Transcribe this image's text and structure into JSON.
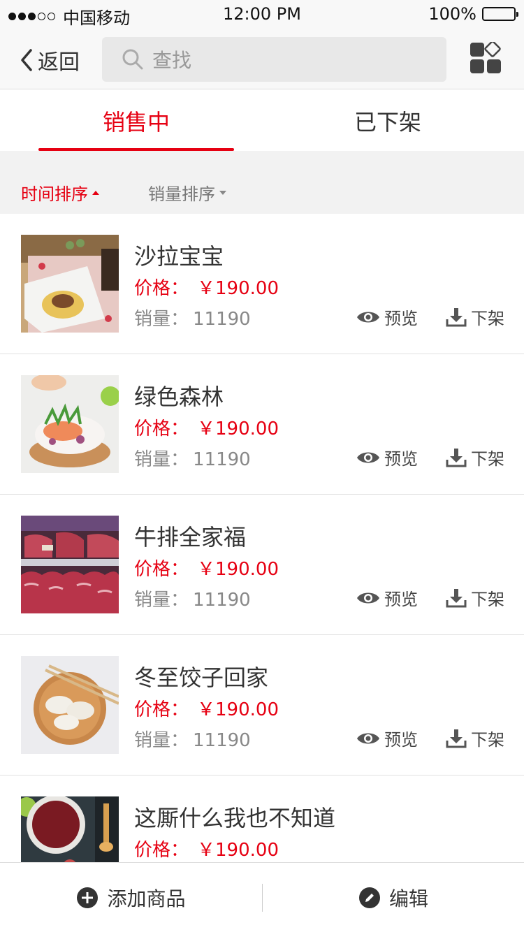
{
  "status_bar": {
    "signal_dots": [
      "on",
      "on",
      "on",
      "off",
      "off"
    ],
    "carrier": "中国移动",
    "time": "12:00 PM",
    "battery": "100%"
  },
  "nav": {
    "back_label": "返回",
    "search_placeholder": "查找",
    "grid_icon": "apps-grid-icon"
  },
  "tabs": [
    {
      "label": "销售中",
      "active": true
    },
    {
      "label": "已下架",
      "active": false
    }
  ],
  "sort": [
    {
      "label": "时间排序",
      "active": true,
      "direction": "up"
    },
    {
      "label": "销量排序",
      "active": false,
      "direction": "down"
    }
  ],
  "product_labels": {
    "price_label": "价格：",
    "sales_label": "销量：",
    "preview": "预览",
    "off_shelf": "下架"
  },
  "products": [
    {
      "name": "沙拉宝宝",
      "price": "￥190.00",
      "sales": "11190"
    },
    {
      "name": "绿色森林",
      "price": "￥190.00",
      "sales": "11190"
    },
    {
      "name": "牛排全家福",
      "price": "￥190.00",
      "sales": "11190"
    },
    {
      "name": "冬至饺子回家",
      "price": "￥190.00",
      "sales": "11190"
    },
    {
      "name": "这厮什么我也不知道",
      "price": "￥190.00",
      "sales": ""
    }
  ],
  "bottom_bar": {
    "add_label": "添加商品",
    "edit_label": "编辑"
  },
  "colors": {
    "accent": "#e60012",
    "text": "#333333",
    "muted": "#888888",
    "bar_bg": "#f8f8f8",
    "sort_bg": "#f2f2f2"
  }
}
